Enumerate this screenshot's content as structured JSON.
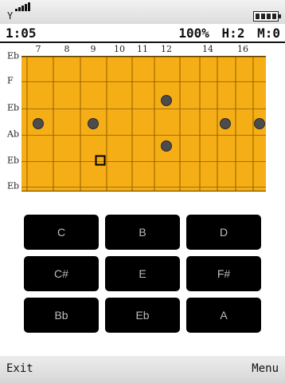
{
  "timer": "1:05",
  "stats": {
    "percent": "100%",
    "hits": "H:2",
    "misses": "M:0"
  },
  "fret_numbers": [
    "7",
    "8",
    "9",
    "10",
    "11",
    "12",
    "14",
    "16"
  ],
  "strings": [
    "Eb",
    "F",
    "Eb",
    "Ab",
    "Eb",
    "Eb"
  ],
  "markers": [
    {
      "string": 2,
      "fret_index": 5
    },
    {
      "string": 3,
      "fret_index": 0
    },
    {
      "string": 3,
      "fret_index": 2
    },
    {
      "string": 3,
      "fret_index": 7
    },
    {
      "string": 3,
      "fret_index": 8
    },
    {
      "string": 4,
      "fret_index": 5
    }
  ],
  "cursor": {
    "string": 5,
    "fret_index": 2
  },
  "note_buttons": [
    "C",
    "B",
    "D",
    "C#",
    "E",
    "F#",
    "Bb",
    "Eb",
    "A"
  ],
  "softkeys": {
    "left": "Exit",
    "right": "Menu"
  },
  "colors": {
    "board": "#f6ae16",
    "button": "#000000",
    "button_text": "#bdbdbd"
  }
}
